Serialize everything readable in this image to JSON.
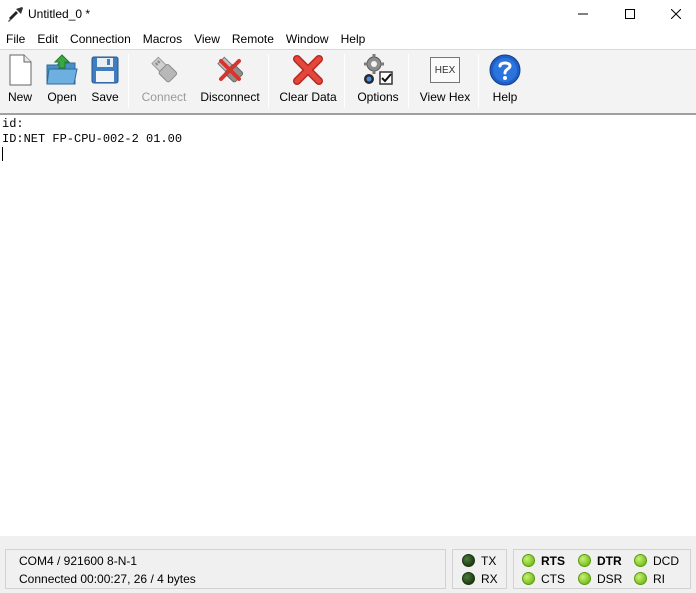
{
  "window": {
    "title": "Untitled_0 *",
    "controls": {
      "minimize_icon": "minimize-icon",
      "maximize_icon": "maximize-icon",
      "close_icon": "close-icon"
    }
  },
  "menu": {
    "items": [
      "File",
      "Edit",
      "Connection",
      "Macros",
      "View",
      "Remote",
      "Window",
      "Help"
    ]
  },
  "toolbar": {
    "new_label": "New",
    "open_label": "Open",
    "save_label": "Save",
    "connect_label": "Connect",
    "disconnect_label": "Disconnect",
    "clear_label": "Clear Data",
    "options_label": "Options",
    "viewhex_label": "View Hex",
    "viewhex_icon_text": "HEX",
    "help_label": "Help"
  },
  "terminal": {
    "lines": [
      "id:",
      "ID:NET FP-CPU-002-2 01.00"
    ]
  },
  "status": {
    "port_settings": "COM4 / 921600 8-N-1",
    "connection": "Connected 00:00:27, 26 / 4 bytes",
    "tx": "TX",
    "rx": "RX",
    "rts": "RTS",
    "cts": "CTS",
    "dtr": "DTR",
    "dsr": "DSR",
    "dcd": "DCD",
    "ri": "RI"
  },
  "colors": {
    "led_active": "#7cc21f",
    "led_inactive": "#1f3f16",
    "toolbar_bg": "#f3f3f3",
    "clear_red": "#d9342b",
    "help_blue": "#1f5fc4"
  }
}
